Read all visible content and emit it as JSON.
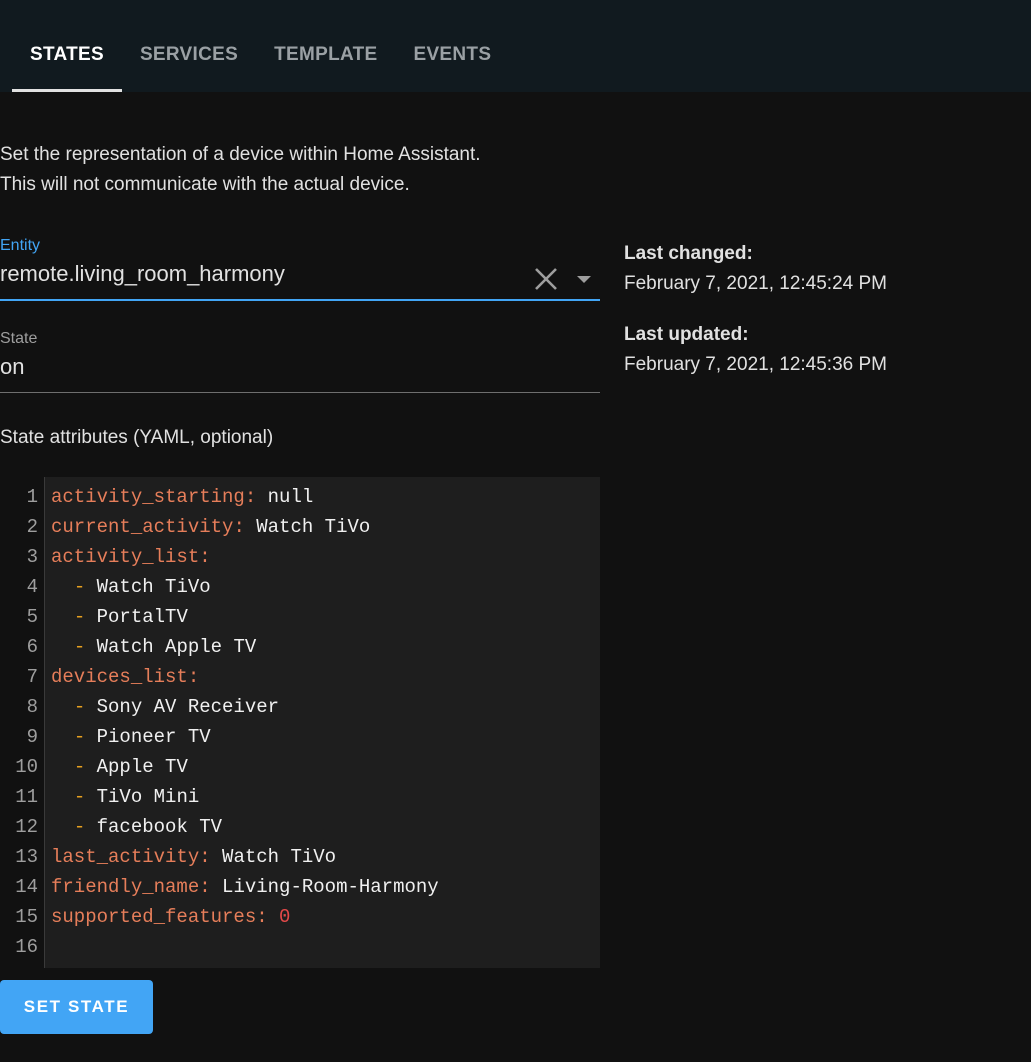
{
  "tabs": [
    {
      "label": "STATES",
      "active": true
    },
    {
      "label": "SERVICES",
      "active": false
    },
    {
      "label": "TEMPLATE",
      "active": false
    },
    {
      "label": "EVENTS",
      "active": false
    }
  ],
  "description": {
    "line1": "Set the representation of a device within Home Assistant.",
    "line2": "This will not communicate with the actual device."
  },
  "entity": {
    "label": "Entity",
    "value": "remote.living_room_harmony"
  },
  "state": {
    "label": "State",
    "value": "on"
  },
  "attributes": {
    "label": "State attributes (YAML, optional)",
    "lines": [
      {
        "num": "1",
        "key": "activity_starting",
        "value": "null"
      },
      {
        "num": "2",
        "key": "current_activity",
        "value": "Watch TiVo"
      },
      {
        "num": "3",
        "key": "activity_list",
        "value": ""
      },
      {
        "num": "4",
        "item": "Watch TiVo"
      },
      {
        "num": "5",
        "item": "PortalTV"
      },
      {
        "num": "6",
        "item": "Watch Apple TV"
      },
      {
        "num": "7",
        "key": "devices_list",
        "value": ""
      },
      {
        "num": "8",
        "item": "Sony AV Receiver"
      },
      {
        "num": "9",
        "item": "Pioneer TV"
      },
      {
        "num": "10",
        "item": "Apple TV"
      },
      {
        "num": "11",
        "item": "TiVo Mini"
      },
      {
        "num": "12",
        "item": "facebook TV"
      },
      {
        "num": "13",
        "key": "last_activity",
        "value": "Watch TiVo"
      },
      {
        "num": "14",
        "key": "friendly_name",
        "value": "Living-Room-Harmony"
      },
      {
        "num": "15",
        "key": "supported_features",
        "number": "0"
      },
      {
        "num": "16"
      }
    ]
  },
  "set_state_label": "SET STATE",
  "last_changed": {
    "label": "Last changed:",
    "value": "February 7, 2021, 12:45:24 PM"
  },
  "last_updated": {
    "label": "Last updated:",
    "value": "February 7, 2021, 12:45:36 PM"
  },
  "colors": {
    "accent": "#42a5f5",
    "yaml_key": "#e67e5a",
    "yaml_dash": "#e6a020",
    "yaml_number": "#e34949"
  },
  "icons": [
    "close-icon",
    "dropdown-arrow-icon"
  ]
}
